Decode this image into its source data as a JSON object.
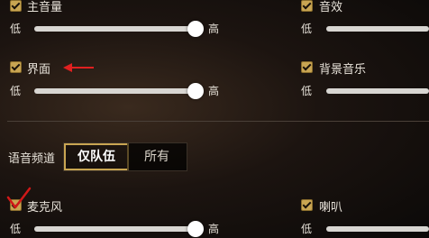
{
  "master_volume": {
    "label": "主音量",
    "low": "低",
    "high": "高",
    "value": 0.83,
    "checked": true
  },
  "sfx": {
    "label": "音效",
    "low": "低",
    "checked": true
  },
  "interface": {
    "label": "界面",
    "low": "低",
    "high": "高",
    "value": 0.83,
    "checked": true
  },
  "bgm": {
    "label": "背景音乐",
    "low": "低",
    "checked": true
  },
  "voice_channel": {
    "label": "语音频道",
    "tabs": [
      "仅队伍",
      "所有"
    ],
    "selected": "仅队伍"
  },
  "microphone": {
    "label": "麦克风",
    "low": "低",
    "high": "高",
    "value": 0.83,
    "checked": true
  },
  "speaker": {
    "label": "喇叭",
    "low": "低",
    "checked": true
  },
  "annotation_colors": {
    "arrow": "#e02020",
    "checkmark": "#d01818"
  }
}
